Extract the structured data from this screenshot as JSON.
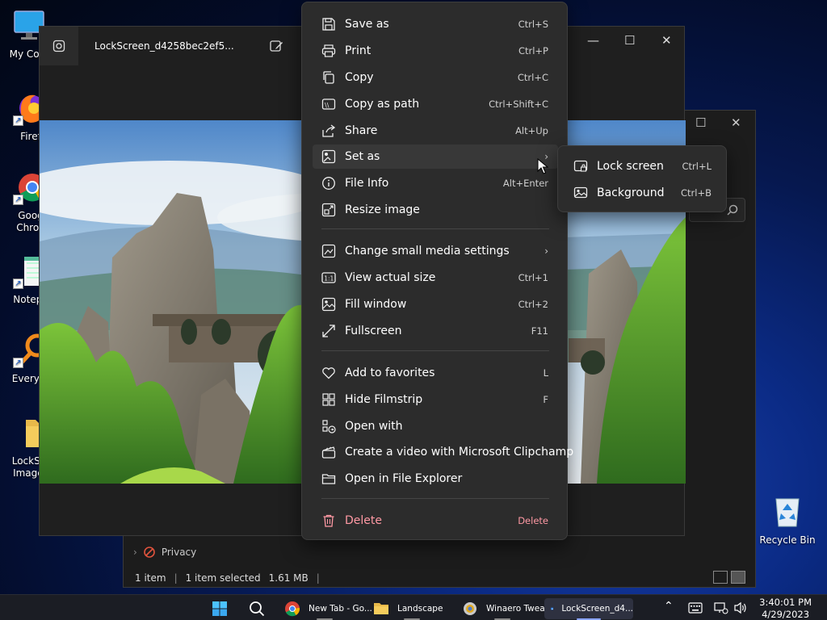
{
  "desktop": {
    "icons": [
      {
        "label": "My Com"
      },
      {
        "label": "Firef"
      },
      {
        "label": "Goog Chron"
      },
      {
        "label": "Notepa"
      },
      {
        "label": "Everyth"
      },
      {
        "label": "LockScr Images"
      }
    ],
    "recycle_bin": "Recycle Bin"
  },
  "explorer": {
    "privacy_label": "Privacy",
    "status": {
      "items": "1 item",
      "selected": "1 item selected",
      "size": "1.61 MB"
    }
  },
  "photos": {
    "title": "LockScreen_d4258bec2ef5..."
  },
  "context_menu": {
    "items": [
      {
        "label": "Save as",
        "shortcut": "Ctrl+S",
        "icon": "save-icon"
      },
      {
        "label": "Print",
        "shortcut": "Ctrl+P",
        "icon": "print-icon"
      },
      {
        "label": "Copy",
        "shortcut": "Ctrl+C",
        "icon": "copy-icon"
      },
      {
        "label": "Copy as path",
        "shortcut": "Ctrl+Shift+C",
        "icon": "copy-path-icon"
      },
      {
        "label": "Share",
        "shortcut": "Alt+Up",
        "icon": "share-icon"
      },
      {
        "label": "Set as",
        "shortcut": "",
        "icon": "set-as-icon"
      },
      {
        "label": "File Info",
        "shortcut": "Alt+Enter",
        "icon": "info-icon"
      },
      {
        "label": "Resize image",
        "shortcut": "",
        "icon": "resize-icon"
      },
      {
        "label": "Change small media settings",
        "shortcut": "",
        "icon": "media-settings-icon"
      },
      {
        "label": "View actual size",
        "shortcut": "Ctrl+1",
        "icon": "actual-size-icon"
      },
      {
        "label": "Fill window",
        "shortcut": "Ctrl+2",
        "icon": "fill-window-icon"
      },
      {
        "label": "Fullscreen",
        "shortcut": "F11",
        "icon": "fullscreen-icon"
      },
      {
        "label": "Add to favorites",
        "shortcut": "L",
        "icon": "heart-icon"
      },
      {
        "label": "Hide Filmstrip",
        "shortcut": "F",
        "icon": "filmstrip-icon"
      },
      {
        "label": "Open with",
        "shortcut": "",
        "icon": "open-with-icon"
      },
      {
        "label": "Create a video with Microsoft Clipchamp",
        "shortcut": "",
        "icon": "clipchamp-icon"
      },
      {
        "label": "Open in File Explorer",
        "shortcut": "",
        "icon": "folder-icon"
      },
      {
        "label": "Delete",
        "shortcut": "Delete",
        "icon": "trash-icon"
      }
    ]
  },
  "submenu": {
    "items": [
      {
        "label": "Lock screen",
        "shortcut": "Ctrl+L",
        "icon": "lock-screen-icon"
      },
      {
        "label": "Background",
        "shortcut": "Ctrl+B",
        "icon": "background-icon"
      }
    ]
  },
  "taskbar": {
    "apps": [
      {
        "label": "New Tab - Go...",
        "icon": "chrome-icon"
      },
      {
        "label": "Landscape",
        "icon": "folder-icon"
      },
      {
        "label": "Winaero Twea...",
        "icon": "winaero-icon"
      },
      {
        "label": "LockScreen_d4...",
        "icon": "photos-icon"
      }
    ],
    "time": "3:40:01 PM",
    "date": "4/29/2023"
  },
  "colors": {
    "menu_bg": "#2c2c2c",
    "danger": "#ff99a4",
    "accent": "#8aa4ff"
  }
}
